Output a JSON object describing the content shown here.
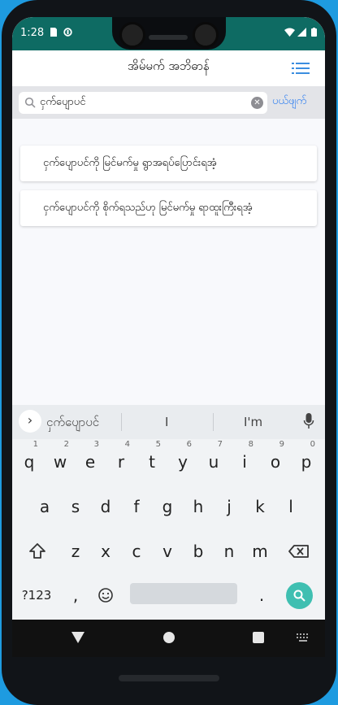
{
  "status": {
    "time": "1:28"
  },
  "appbar": {
    "title": "အိမ်မက် အဘိဓာန်"
  },
  "search": {
    "value": "ငှက်ပျောပင်",
    "cancel": "ပယ်ဖျက်"
  },
  "results": [
    "ငှက်ပျောပင်ကို မြင်မက်မှု ရွာအရပ်ပြောင်းရအံ့",
    "ငှက်ပျောပင်ကို စိုက်ရသည်ဟု မြင်မက်မှု ရာထူးကြီးရအံ့"
  ],
  "suggestions": [
    "ငှက်ပျောပင်",
    "I",
    "I'm"
  ],
  "keyboard": {
    "row1": [
      "q",
      "w",
      "e",
      "r",
      "t",
      "y",
      "u",
      "i",
      "o",
      "p"
    ],
    "row1_hints": [
      "1",
      "2",
      "3",
      "4",
      "5",
      "6",
      "7",
      "8",
      "9",
      "0"
    ],
    "row2": [
      "a",
      "s",
      "d",
      "f",
      "g",
      "h",
      "j",
      "k",
      "l"
    ],
    "row3": [
      "z",
      "x",
      "c",
      "v",
      "b",
      "n",
      "m"
    ],
    "symbols": "?123",
    "comma": ",",
    "period": "."
  },
  "colors": {
    "accent": "#2f7ff0",
    "statusbar": "#0e6b63",
    "enter": "#3fbfb1"
  }
}
